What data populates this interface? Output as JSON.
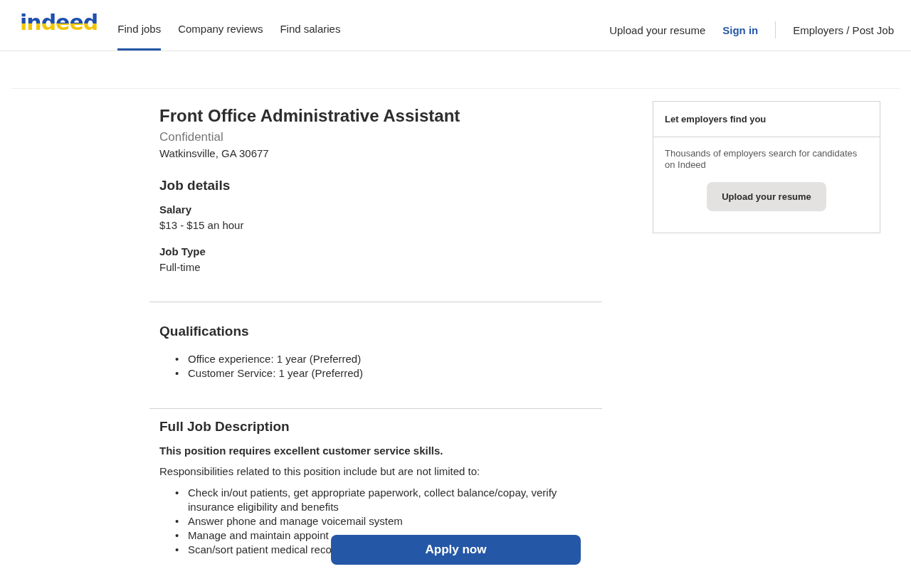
{
  "header": {
    "logo": "indeed",
    "nav": [
      {
        "label": "Find jobs",
        "selected": true
      },
      {
        "label": "Company reviews",
        "selected": false
      },
      {
        "label": "Find salaries",
        "selected": false
      }
    ],
    "right_links": [
      {
        "label": "Upload your resume",
        "kind": "plain"
      },
      {
        "label": "Sign in",
        "kind": "accent"
      },
      {
        "label": "Employers / Post Job",
        "kind": "divided"
      }
    ]
  },
  "job": {
    "title": "Front Office Administrative Assistant",
    "company": "Confidential",
    "location": "Watkinsville, GA 30677",
    "details_heading": "Job details",
    "details": [
      {
        "label": "Salary",
        "value": "$13 - $15 an hour"
      },
      {
        "label": "Job Type",
        "value": "Full-time"
      }
    ],
    "bullet": "•",
    "qualifications_heading": "Qualifications",
    "qualifications": [
      "Office experience: 1 year (Preferred)",
      "Customer Service: 1 year (Preferred)"
    ],
    "description_heading": "Full Job Description",
    "description_lead": "This position requires excellent customer service skills.",
    "description_intro": "Responsibilities related to this position include but are not limited to:",
    "responsibilities": [
      "Check in/out patients, get appropriate paperwork, collect balance/copay, verify insurance eligibility and benefits",
      "Answer phone and manage voicemail system",
      "Manage and maintain appoint",
      "Scan/sort patient medical reco"
    ]
  },
  "sidebar": {
    "title": "Let employers find you",
    "text": "Thousands of employers search for candidates on Indeed",
    "button": "Upload your resume"
  },
  "apply_button": "Apply now"
}
